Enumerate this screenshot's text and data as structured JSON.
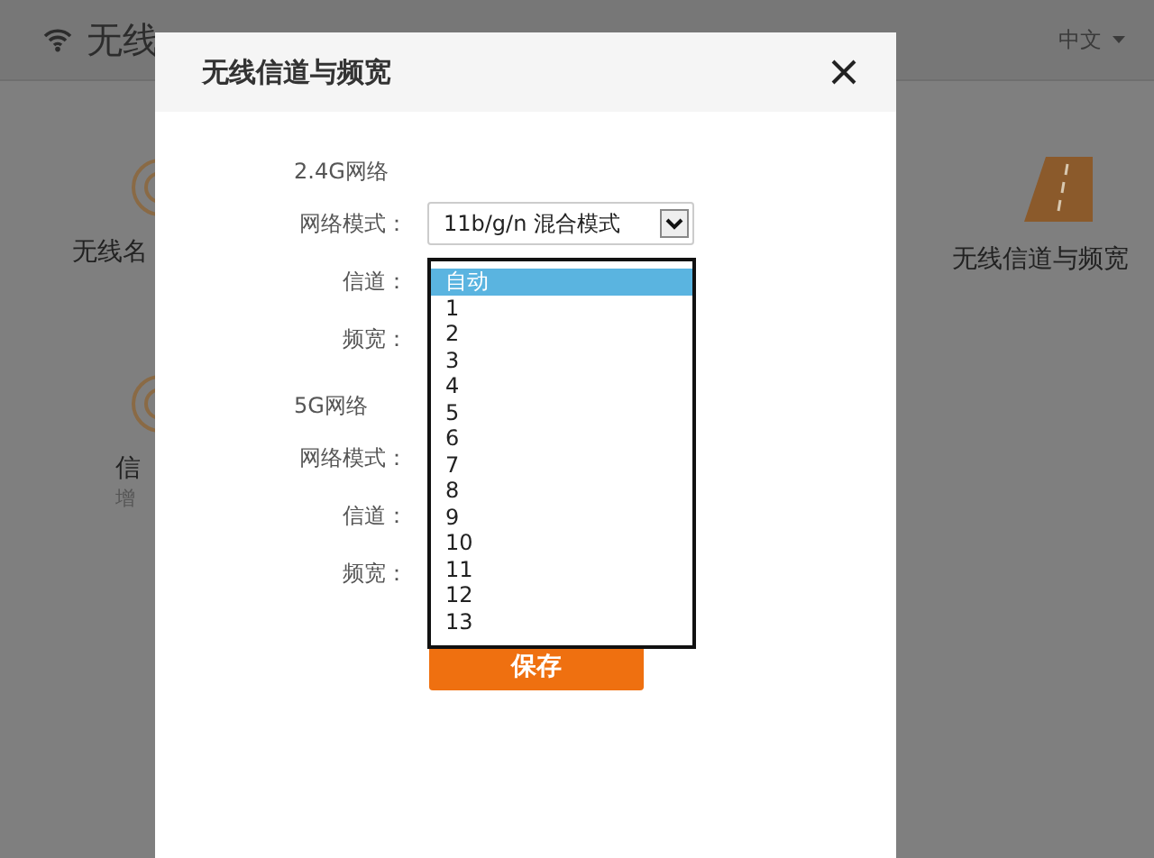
{
  "page": {
    "title": "无线",
    "language": "中文",
    "tiles": [
      {
        "kind": "ring",
        "title": "无线名"
      },
      {
        "kind": "ring",
        "title": "信",
        "subtitle": "增"
      },
      {
        "kind": "road",
        "title": "无线信道与频宽"
      }
    ]
  },
  "dialog": {
    "title": "无线信道与频宽",
    "sections": [
      {
        "heading": "2.4G网络",
        "fields": [
          {
            "kind": "select",
            "label": "网络模式：",
            "value": "11b/g/n 混合模式"
          },
          {
            "kind": "covered",
            "label": "信道："
          },
          {
            "kind": "covered",
            "label": "频宽："
          }
        ]
      },
      {
        "heading": "5G网络",
        "fields": [
          {
            "kind": "covered",
            "label": "网络模式："
          },
          {
            "kind": "covered",
            "label": "信道："
          },
          {
            "kind": "covered",
            "label": "频宽："
          }
        ]
      }
    ],
    "dropdown": {
      "options": [
        {
          "label": "自动",
          "selected": true
        },
        {
          "label": "1",
          "selected": false
        },
        {
          "label": "2",
          "selected": false
        },
        {
          "label": "3",
          "selected": false
        },
        {
          "label": "4",
          "selected": false
        },
        {
          "label": "5",
          "selected": false
        },
        {
          "label": "6",
          "selected": false
        },
        {
          "label": "7",
          "selected": false
        },
        {
          "label": "8",
          "selected": false
        },
        {
          "label": "9",
          "selected": false
        },
        {
          "label": "10",
          "selected": false
        },
        {
          "label": "11",
          "selected": false
        },
        {
          "label": "12",
          "selected": false
        },
        {
          "label": "13",
          "selected": false
        }
      ]
    },
    "save_button": "保存"
  }
}
